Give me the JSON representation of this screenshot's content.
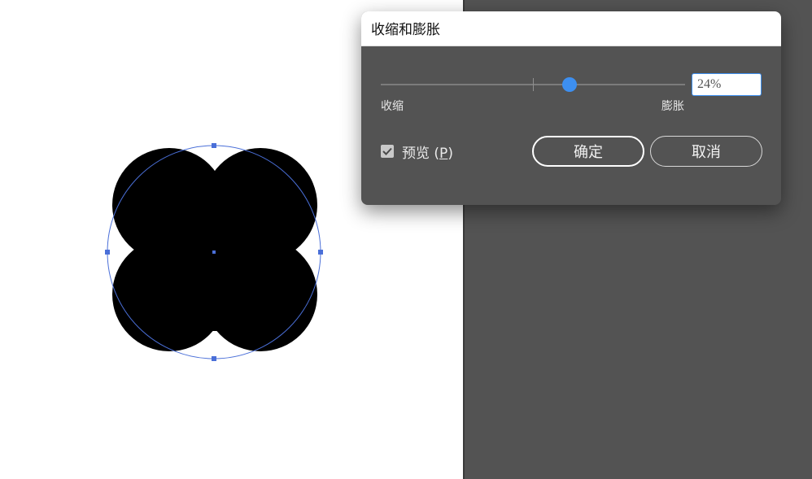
{
  "dialog": {
    "title": "收缩和膨胀",
    "slider": {
      "value_percent": 24,
      "min_label": "收缩",
      "max_label": "膨胀"
    },
    "value_input": "24%",
    "preview": {
      "label": "预览",
      "accelerator": "P",
      "checked": true
    },
    "buttons": {
      "ok": "确定",
      "cancel": "取消"
    }
  },
  "colors": {
    "accent": "#3d8ff0",
    "dialog_bg": "#535353",
    "pasteboard": "#535353",
    "selection": "#4a6fd8"
  },
  "artwork": {
    "shape": "four-lobed-clover",
    "selection_bounds": "circle-with-handles"
  }
}
